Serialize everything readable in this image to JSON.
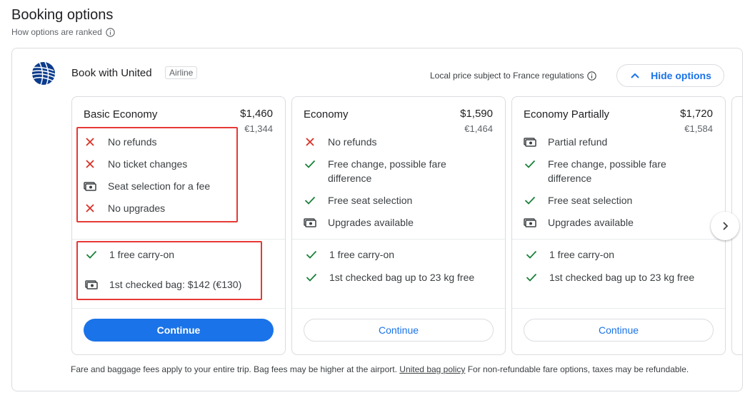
{
  "page": {
    "heading": "Booking options",
    "ranked_label": "How options are ranked"
  },
  "provider": {
    "title": "Book with United",
    "badge": "Airline",
    "local_price_note": "Local price subject to France regulations",
    "hide_options_label": "Hide options"
  },
  "cards": [
    {
      "name": "Basic Economy",
      "price": "$1,460",
      "price_eur": "€1,344",
      "features": [
        {
          "icon": "x-icon",
          "text": "No refunds"
        },
        {
          "icon": "x-icon",
          "text": "No ticket changes"
        },
        {
          "icon": "money-icon",
          "text": "Seat selection for a fee"
        },
        {
          "icon": "x-icon",
          "text": "No upgrades"
        }
      ],
      "bags": [
        {
          "icon": "check-icon",
          "text": "1 free carry-on"
        },
        {
          "icon": "money-icon",
          "text": "1st checked bag: $142 (€130)"
        }
      ],
      "continue_label": "Continue",
      "continue_style": "primary"
    },
    {
      "name": "Economy",
      "price": "$1,590",
      "price_eur": "€1,464",
      "features": [
        {
          "icon": "x-icon",
          "text": "No refunds"
        },
        {
          "icon": "check-icon",
          "text": "Free change, possible fare difference"
        },
        {
          "icon": "check-icon",
          "text": "Free seat selection"
        },
        {
          "icon": "money-icon",
          "text": "Upgrades available"
        }
      ],
      "bags": [
        {
          "icon": "check-icon",
          "text": "1 free carry-on"
        },
        {
          "icon": "check-icon",
          "text": "1st checked bag up to 23 kg free"
        }
      ],
      "continue_label": "Continue",
      "continue_style": "secondary"
    },
    {
      "name": "Economy Partially",
      "price": "$1,720",
      "price_eur": "€1,584",
      "features": [
        {
          "icon": "money-icon",
          "text": "Partial refund"
        },
        {
          "icon": "check-icon",
          "text": "Free change, possible fare difference"
        },
        {
          "icon": "check-icon",
          "text": "Free seat selection"
        },
        {
          "icon": "money-icon",
          "text": "Upgrades available"
        }
      ],
      "bags": [
        {
          "icon": "check-icon",
          "text": "1 free carry-on"
        },
        {
          "icon": "check-icon",
          "text": "1st checked bag up to 23 kg free"
        }
      ],
      "continue_label": "Continue",
      "continue_style": "secondary"
    }
  ],
  "footer": {
    "text_before": "Fare and baggage fees apply to your entire trip. Bag fees may be higher at the airport.",
    "link": "United bag policy",
    "text_after": "For non-refundable fare options, taxes may be refundable."
  },
  "colors": {
    "accent": "#1a73e8",
    "x_red": "#d93025",
    "check_green": "#188038",
    "highlight_red": "#e53935"
  }
}
